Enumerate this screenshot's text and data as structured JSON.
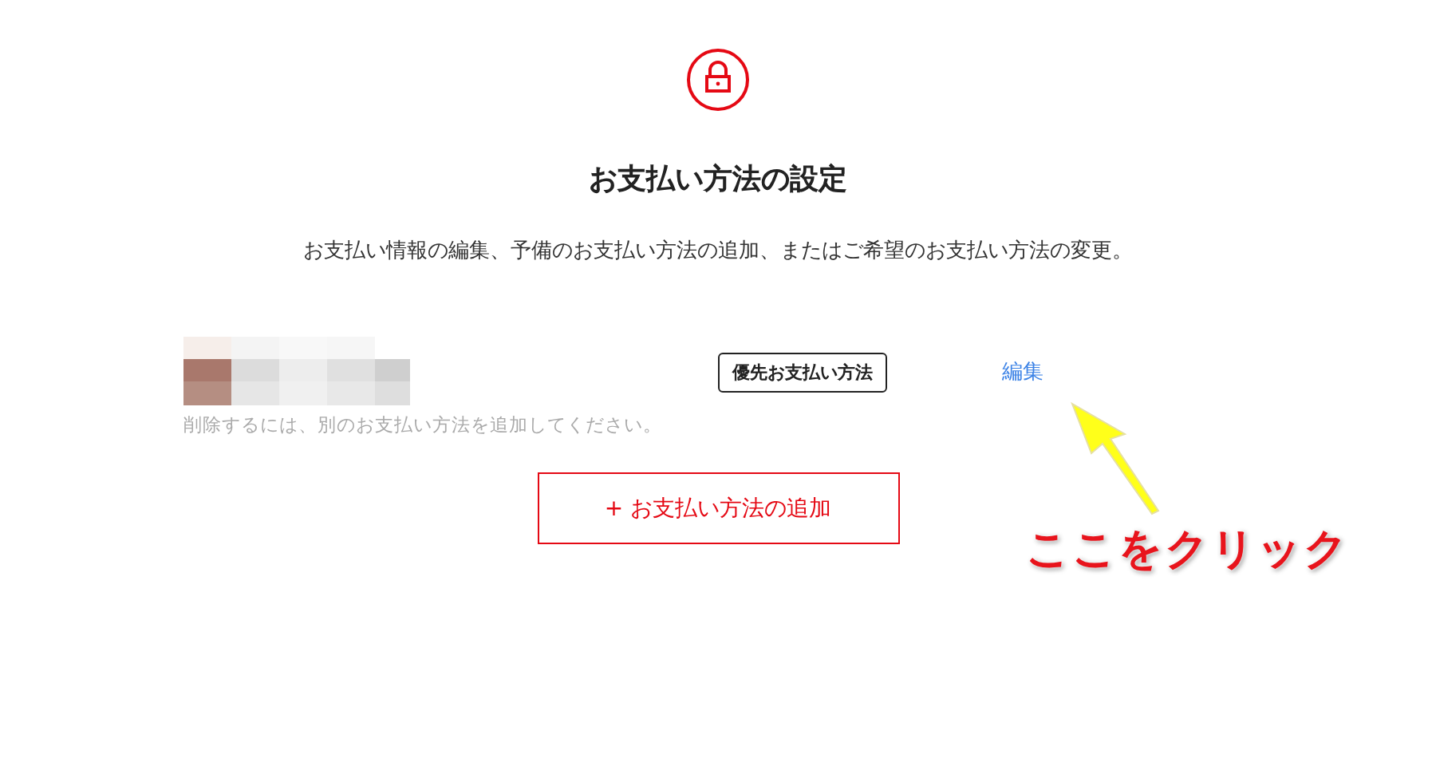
{
  "header": {
    "title": "お支払い方法の設定",
    "description": "お支払い情報の編集、予備のお支払い方法の追加、またはご希望のお支払い方法の変更。"
  },
  "payment_method": {
    "badge": "優先お支払い方法",
    "edit_link": "編集",
    "note": "削除するには、別のお支払い方法を追加してください。"
  },
  "add_button": "+ お支払い方法の追加",
  "annotation": {
    "text": "ここをクリック"
  }
}
